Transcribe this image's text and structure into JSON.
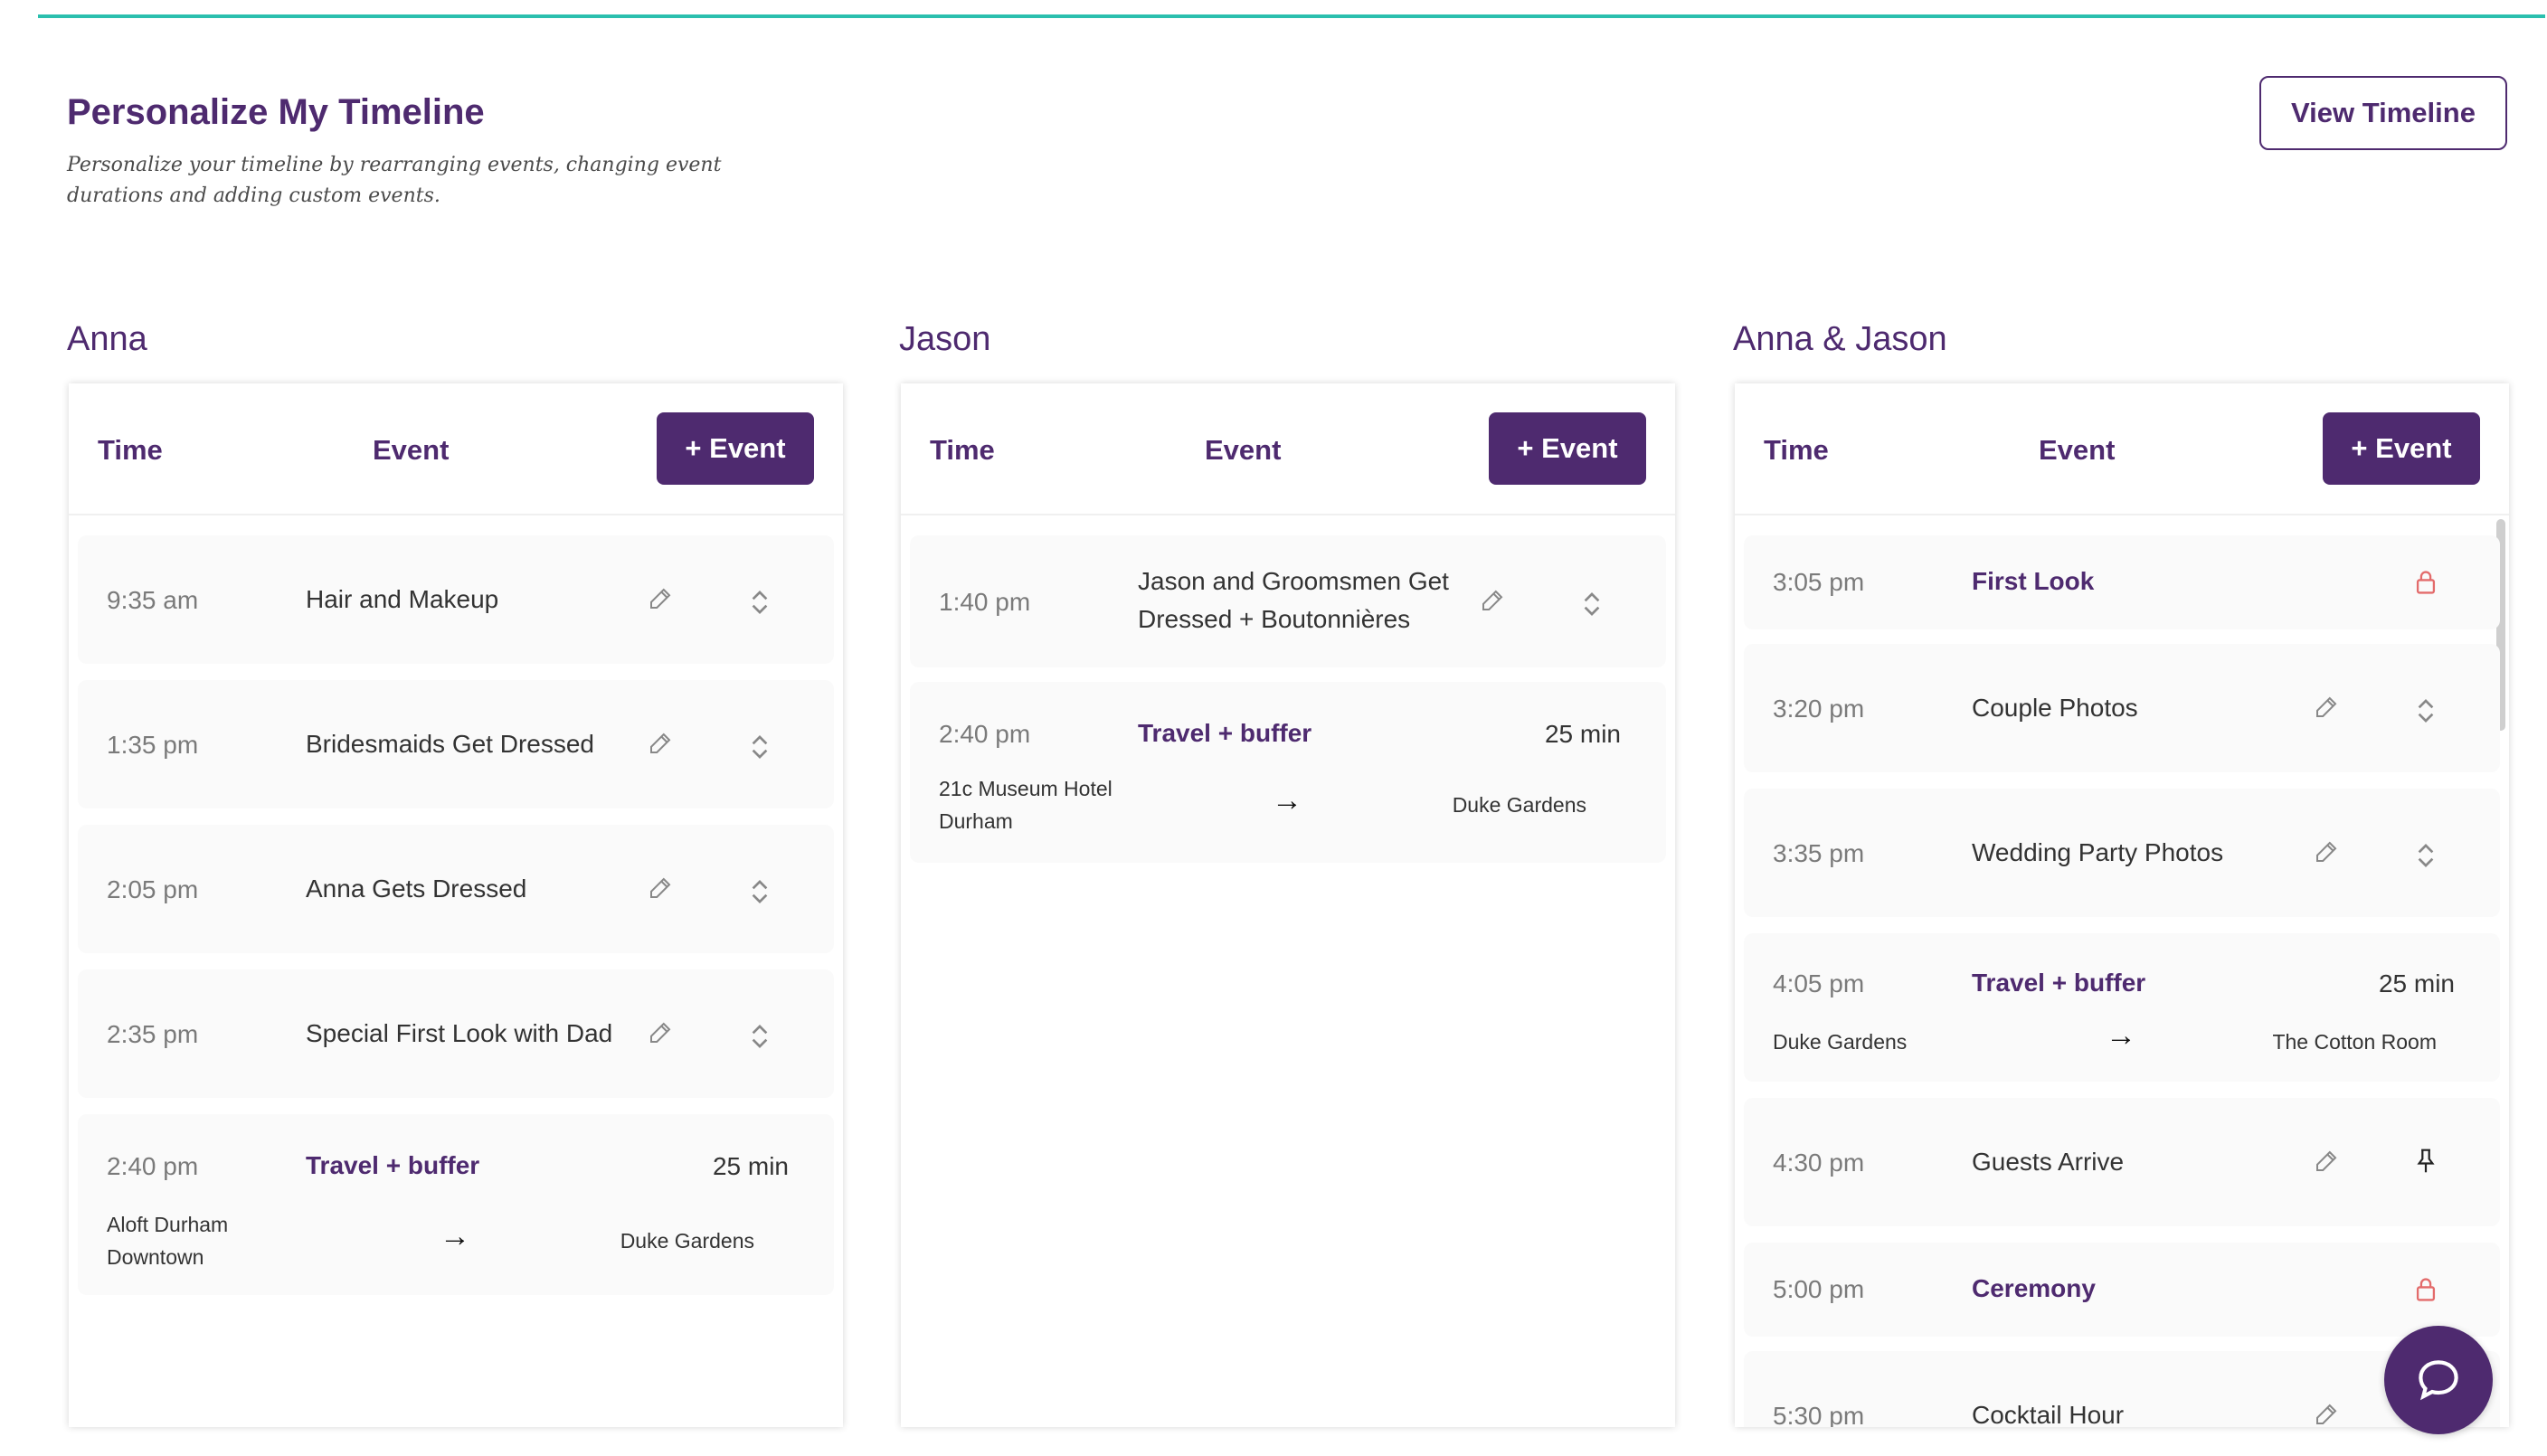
{
  "page": {
    "title": "Personalize My Timeline",
    "subtitle": "Personalize your timeline by rearranging events, changing event durations and adding custom events.",
    "view_button": "View Timeline"
  },
  "colors": {
    "brand": "#4e2a6f",
    "accent_line": "#2bbfae",
    "lock": "#e36b6b"
  },
  "headers": {
    "time": "Time",
    "event": "Event",
    "add": "+ Event"
  },
  "columns": [
    {
      "name": "Anna",
      "rows": [
        {
          "time": "9:35 am",
          "event": "Hair and Makeup"
        },
        {
          "time": "1:35 pm",
          "event": "Bridesmaids Get Dressed"
        },
        {
          "time": "2:05 pm",
          "event": "Anna Gets Dressed"
        },
        {
          "time": "2:35 pm",
          "event": "Special First Look with Dad"
        },
        {
          "time": "2:40 pm",
          "event": "Travel + buffer",
          "duration": "25 min",
          "from": "Aloft Durham Downtown",
          "to": "Duke Gardens"
        }
      ]
    },
    {
      "name": "Jason",
      "rows": [
        {
          "time": "1:40 pm",
          "event": "Jason and Groomsmen Get Dressed + Boutonnières"
        },
        {
          "time": "2:40 pm",
          "event": "Travel + buffer",
          "duration": "25 min",
          "from": "21c Museum Hotel Durham",
          "to": "Duke Gardens"
        }
      ]
    },
    {
      "name": "Anna & Jason",
      "rows": [
        {
          "time": "3:05 pm",
          "event": "First Look"
        },
        {
          "time": "3:20 pm",
          "event": "Couple Photos"
        },
        {
          "time": "3:35 pm",
          "event": "Wedding Party Photos"
        },
        {
          "time": "4:05 pm",
          "event": "Travel + buffer",
          "duration": "25 min",
          "from": "Duke Gardens",
          "to": "The Cotton Room"
        },
        {
          "time": "4:30 pm",
          "event": "Guests Arrive"
        },
        {
          "time": "5:00 pm",
          "event": "Ceremony"
        },
        {
          "time": "5:30 pm",
          "event": "Cocktail Hour"
        }
      ]
    }
  ],
  "icons": {
    "edit": "pencil-icon",
    "reorder": "chevron-up-down-icon",
    "locked": "lock-icon",
    "pinned": "pin-icon",
    "arrow": "→",
    "chat": "chat-bubble-icon"
  }
}
